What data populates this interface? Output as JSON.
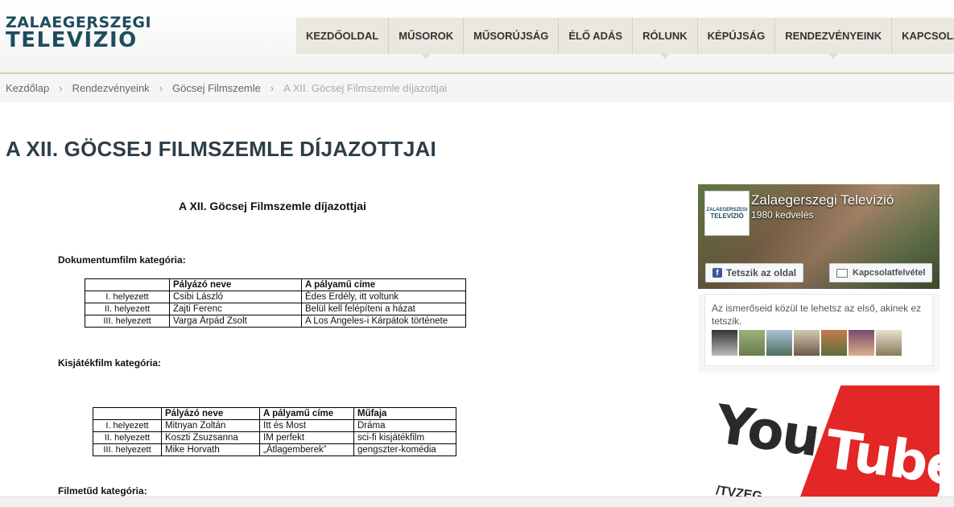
{
  "logo": {
    "line1": "ZALAEGERSZEGI",
    "line2": "TELEVÍZIÓ"
  },
  "nav": [
    "KEZDŐOLDAL",
    "MŰSOROK",
    "MŰSORÚJSÁG",
    "ÉLŐ ADÁS",
    "RÓLUNK",
    "KÉPÚJSÁG",
    "RENDEZVÉNYEINK",
    "KAPCSOLAT"
  ],
  "breadcrumb": {
    "home": "Kezdőlap",
    "level1": "Rendezvényeink",
    "level2": "Göcsej Filmszemle",
    "current": "A XII. Göcsej Filmszemle díjazottjai",
    "separator": "›"
  },
  "page_title": "A XII. GÖCSEJ FILMSZEMLE DÍJAZOTTJAI",
  "doc": {
    "title": "A XII. Göcsej Filmszemle díjazottjai",
    "cat1": {
      "label": "Dokumentumfilm kategória:",
      "headers": [
        "",
        "Pályázó neve",
        "A pályamű címe"
      ],
      "rows": [
        [
          "I. helyezett",
          "Csibi László",
          "Édes Erdély, itt voltunk"
        ],
        [
          "II. helyezett",
          "Zajti Ferenc",
          "Belül kell felépíteni a házat"
        ],
        [
          "III. helyezett",
          "Varga Árpád Zsolt",
          "A Los Angeles-i Kárpátok története"
        ]
      ]
    },
    "cat2": {
      "label": "Kisjátékfilm kategória:",
      "headers": [
        "",
        "Pályázó neve",
        "A pályamű címe",
        "Műfaja"
      ],
      "rows": [
        [
          "I. helyezett",
          "Mitnyan Zoltán",
          "Itt és Most",
          "Dráma"
        ],
        [
          "II. helyezett",
          "Koszti Zsuzsanna",
          "IM perfekt",
          "sci-fi kisjátékfilm"
        ],
        [
          "III. helyezett",
          "Mike Horvath",
          "„Átlagemberek”",
          "gengszter-komédia"
        ]
      ]
    },
    "cat3": {
      "label": "Filmetűd kategória:"
    }
  },
  "facebook": {
    "page_name": "Zalaegerszegi Televízió",
    "likes": "1980 kedvelés",
    "like_button": "Tetszik az oldal",
    "contact_button": "Kapcsolatfelvétel",
    "friends_text": "Az ismerőseid közül te lehetsz az első, akinek ez tetszik.",
    "thumb_line1": "ZALAEGERSZEGI",
    "thumb_line2": "TELEVÍZIÓ"
  },
  "youtube": {
    "word1": "You",
    "word2": "Tube",
    "sub": "/TVZEG"
  },
  "colors": {
    "brand": "#1d4d5e",
    "title": "#2c3e48",
    "fb": "#3b5998",
    "yt_red": "#e32626"
  }
}
